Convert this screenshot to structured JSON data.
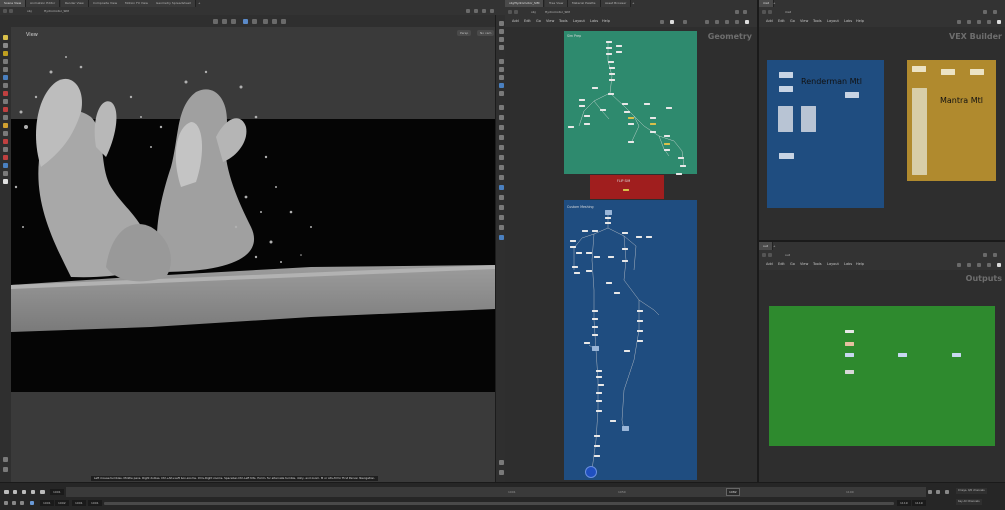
{
  "top_tabs": [
    "Scene View",
    "Animation Editor",
    "Render View",
    "Composite View",
    "Motion FX View",
    "Geometry Spreadsheet"
  ],
  "viewport": {
    "path_obj": "obj",
    "path_node": "Hydromotor_SIM",
    "title": "View",
    "persp_label": "Persp",
    "camera_label": "No cam",
    "status_message": "Left mouse tumbles. Middle pans. Right dollies. Ctrl+Alt+Left box-zooms. Ctrl+Right zooms. Spacebar-Ctrl-Left tilts. Hold L for alternate tumble, dolly, and zoom. M or Alt+M for First Person Navigation."
  },
  "network_left": {
    "tabs": [
      "obj/Hydromotor_SIM",
      "Tree View",
      "Material Palette",
      "Asset Browser"
    ],
    "path_obj": "obj",
    "path_node": "Hydromotor_SIM",
    "menu": [
      "Add",
      "Edit",
      "Go",
      "View",
      "Tools",
      "Layout",
      "Labs",
      "Help"
    ],
    "context_label": "Geometry",
    "box_sim_prep": "Sim Prep",
    "box_flip_sim": "FLIP SIM",
    "box_meshing": "Custom Meshing",
    "colors": {
      "sim_prep": "#2e8a6e",
      "flip_sim": "#a01e1e",
      "meshing": "#1f4d80"
    }
  },
  "vex_panel": {
    "tabs": [
      "mat"
    ],
    "path": "mat",
    "menu": [
      "Add",
      "Edit",
      "Go",
      "View",
      "Tools",
      "Layout",
      "Labs",
      "Help"
    ],
    "context_label": "VEX Builder",
    "renderman_label": "Renderman Mtl",
    "mantra_label": "Mantra Mtl",
    "colors": {
      "renderman": "#1f4d80",
      "mantra": "#b08a2e"
    }
  },
  "out_panel": {
    "tabs": [
      "out"
    ],
    "path": "out",
    "menu": [
      "Add",
      "Edit",
      "Go",
      "View",
      "Tools",
      "Layout",
      "Labs",
      "Help"
    ],
    "context_label": "Outputs",
    "color": "#2e8a2e"
  },
  "timeline": {
    "frame": "1001",
    "range_start": "1001",
    "range_end": "1002",
    "start_field": "1001",
    "end_field": "1119",
    "end_field2": "1119",
    "ruler_labels": [
      "1001",
      "1050",
      "1100"
    ],
    "current_marker": "1082",
    "keys_label": "0 keys, 0/0 channels",
    "key_all_label": "Key All Channels"
  }
}
